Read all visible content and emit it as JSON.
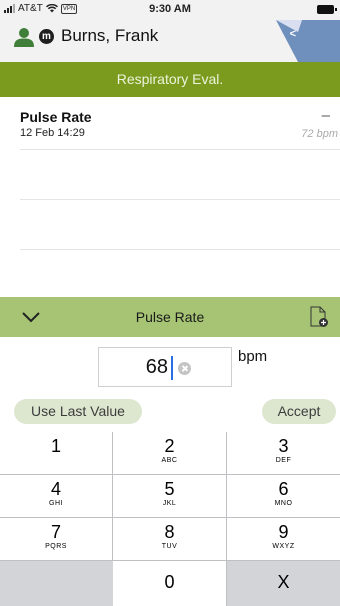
{
  "status_bar": {
    "carrier": "AT&T",
    "vpn": "VPN",
    "time": "9:30 AM"
  },
  "patient": {
    "badge": "m",
    "name": "Burns, Frank"
  },
  "screen_title": "Respiratory Eval.",
  "measurement": {
    "title": "Pulse Rate",
    "date": "12 Feb 14:29",
    "dash": "–",
    "value": "72 bpm"
  },
  "input": {
    "header_title": "Pulse Rate",
    "value": "68",
    "unit": "bpm",
    "use_last_label": "Use Last Value",
    "accept_label": "Accept"
  },
  "keypad": {
    "keys": [
      {
        "num": "1",
        "letters": ""
      },
      {
        "num": "2",
        "letters": "ABC"
      },
      {
        "num": "3",
        "letters": "DEF"
      },
      {
        "num": "4",
        "letters": "GHI"
      },
      {
        "num": "5",
        "letters": "JKL"
      },
      {
        "num": "6",
        "letters": "MNO"
      },
      {
        "num": "7",
        "letters": "PQRS"
      },
      {
        "num": "8",
        "letters": "TUV"
      },
      {
        "num": "9",
        "letters": "WXYZ"
      },
      {
        "num": "0",
        "letters": ""
      },
      {
        "num": "X",
        "letters": ""
      }
    ]
  },
  "colors": {
    "title_bar": "#7a9b1e",
    "input_header": "#a6c474",
    "pill_button": "#dde7d0",
    "tab_accent": "#6f8fbd"
  },
  "icons": [
    "person-icon",
    "chevron-left-icon",
    "chevron-down-icon",
    "document-add-icon",
    "clear-icon"
  ]
}
